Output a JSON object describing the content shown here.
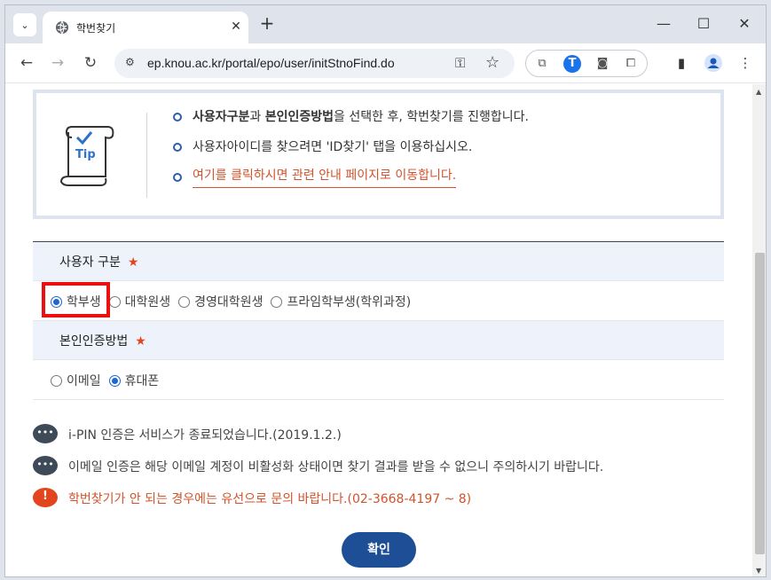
{
  "browser": {
    "tab_title": "학번찾기",
    "url": "ep.knou.ac.kr/portal/epo/user/initStnoFind.do"
  },
  "tip": {
    "icon_label": "Tip",
    "item1_bold1": "사용자구분",
    "item1_mid": "과 ",
    "item1_bold2": "본인인증방법",
    "item1_rest": "을 선택한 후, 학번찾기를 진행합니다.",
    "item2": "사용자아이디를 찾으려면 'ID찾기' 탭을 이용하십시오.",
    "item3": "여기를 클릭하시면 관련 안내 페이지로 이동합니다."
  },
  "form": {
    "user_type_label": "사용자 구분",
    "required_mark": "★",
    "user_type_options": [
      "학부생",
      "대학원생",
      "경영대학원생",
      "프라임학부생(학위과정)"
    ],
    "user_type_selected": "학부생",
    "auth_label": "본인인증방법",
    "auth_options": [
      "이메일",
      "휴대폰"
    ],
    "auth_selected": "휴대폰"
  },
  "notes": {
    "note1": "i-PIN 인증은 서비스가 종료되었습니다.(2019.1.2.)",
    "note2": "이메일 인증은 해당 이메일 계정이 비활성화 상태이면 찾기 결과를 받을 수 없으니 주의하시기 바랍니다.",
    "note3": "학번찾기가 안 되는 경우에는 유선으로 문의 바랍니다.(02-3668-4197 ~ 8)"
  },
  "confirm_label": "확인",
  "colors": {
    "accent_blue": "#1e4f96",
    "warning_orange": "#e2461f",
    "highlight_red": "#ea1010"
  }
}
